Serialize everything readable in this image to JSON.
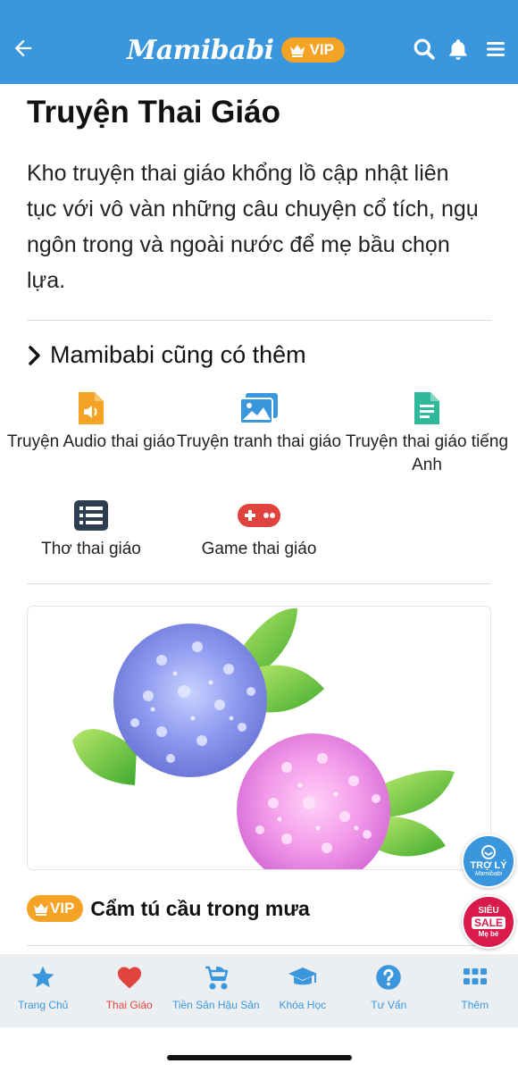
{
  "header": {
    "brand": "Mamibabi",
    "vip_label": "VIP"
  },
  "page": {
    "title": "Truyện Thai Giáo",
    "description": "Kho truyện thai giáo khổng lồ cập nhật liên tục với vô vàn những câu chuyện cổ tích, ngụ ngôn trong và ngoài nước để mẹ bầu chọn lựa."
  },
  "more_section": {
    "title": "Mamibabi cũng có thêm",
    "items": [
      {
        "label": "Truyện Audio thai giáo",
        "icon": "audio-file-icon",
        "color": "#f4a324"
      },
      {
        "label": "Truyện tranh thai giáo",
        "icon": "image-gallery-icon",
        "color": "#3a96dd"
      },
      {
        "label": "Truyện thai giáo tiếng Anh",
        "icon": "document-icon",
        "color": "#2fb89a"
      },
      {
        "label": "Thơ thai giáo",
        "icon": "list-icon",
        "color": "#2c3e50"
      },
      {
        "label": "Game thai giáo",
        "icon": "gamepad-icon",
        "color": "#e0433e"
      }
    ]
  },
  "story": {
    "vip_label": "VIP",
    "title": "Cẩm tú cầu trong mưa"
  },
  "floating": {
    "assistant_line1": "TRỢ LÝ",
    "assistant_line2": "Mamibabi",
    "sale_line1": "SIÊU",
    "sale_line2": "SALE",
    "sale_line3": "Mẹ bé"
  },
  "bottom_nav": {
    "items": [
      {
        "label": "Trang Chủ",
        "icon": "star-icon",
        "active": false
      },
      {
        "label": "Thai Giáo",
        "icon": "heart-icon",
        "active": true
      },
      {
        "label": "Tiền Sản Hậu Sản",
        "icon": "stroller-icon",
        "active": false
      },
      {
        "label": "Khóa Học",
        "icon": "graduation-cap-icon",
        "active": false
      },
      {
        "label": "Tư Vấn",
        "icon": "help-circle-icon",
        "active": false
      },
      {
        "label": "Thêm",
        "icon": "grid-icon",
        "active": false
      }
    ]
  },
  "colors": {
    "primary": "#3a96dd",
    "vip": "#f4a324",
    "active_nav": "#e0433e",
    "sale": "#d81b4b"
  }
}
